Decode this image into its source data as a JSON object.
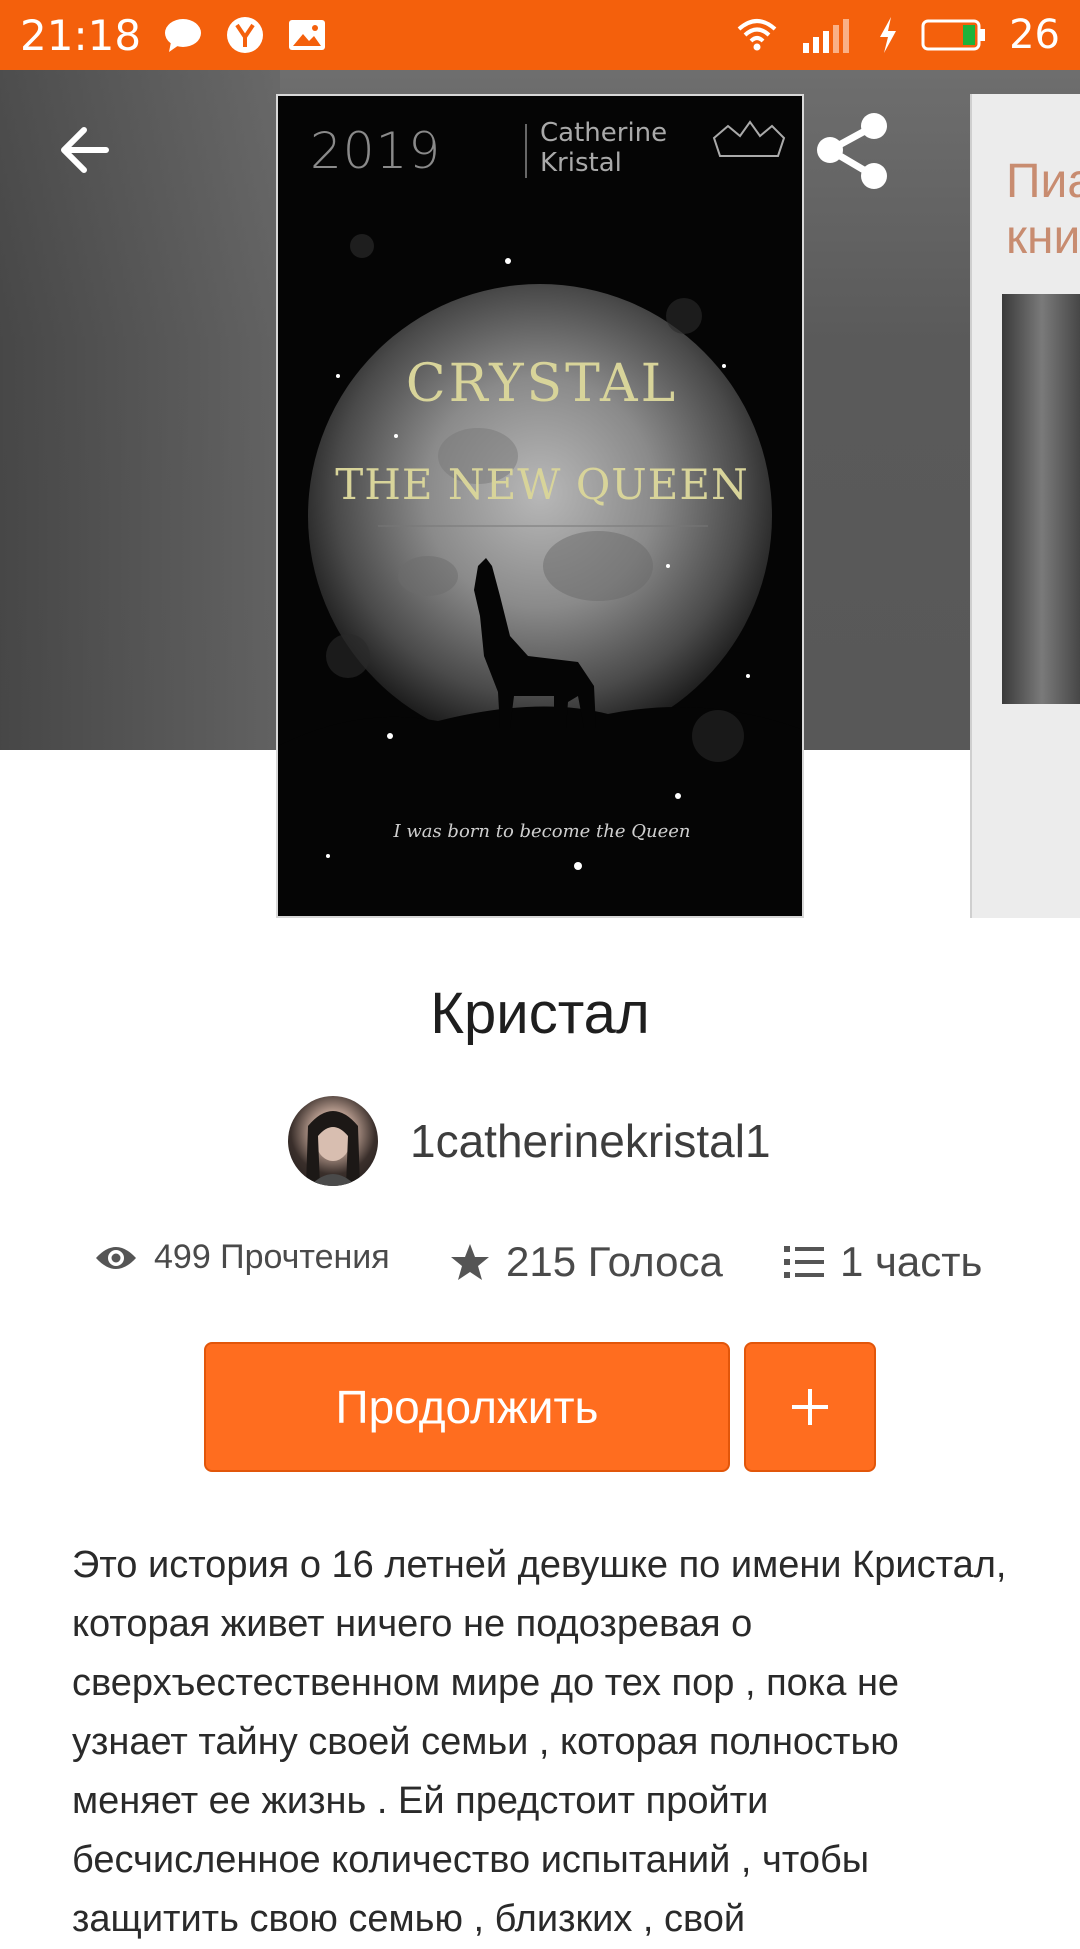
{
  "status_bar": {
    "time": "21:18",
    "battery_level": "26",
    "left_icons": [
      "chat-bubble-icon",
      "yandex-browser-icon",
      "image-notification-icon"
    ],
    "right_icons": [
      "wifi-icon",
      "signal-icon",
      "charging-icon",
      "battery-icon"
    ]
  },
  "header": {
    "icons": [
      "back-arrow-icon",
      "share-icon",
      "more-vert-icon"
    ]
  },
  "cover": {
    "year": "2019",
    "author_line1": "Catherine",
    "author_line2": "Kristal",
    "title": "CRYSTAL",
    "subtitle": "THE NEW QUEEN",
    "tagline": "I was born to become the Queen"
  },
  "next_cover": {
    "text_line1": "Пиа",
    "text_line2": "кни"
  },
  "story": {
    "title": "Кристал",
    "author": "1catherinekristal1",
    "reads": "499 Прочтения",
    "votes": "215 Голоса",
    "parts": "1 часть",
    "continue_label": "Продолжить",
    "add_label": "+",
    "description": "Это история о 16 летней девушке по имени Кристал, которая живет ничего не подозревая о сверхъестественном мире до тех пор , пока не узнает тайну своей семьи , которая полностью меняет ее жизнь . Ей предстоит пройти бесчисленное количество испытаний , чтобы защитить свою семью , близких , свой"
  },
  "colors": {
    "accent": "#ff6d1f",
    "status_bar": "#f4600c",
    "cover_text": "#d8d49a"
  }
}
